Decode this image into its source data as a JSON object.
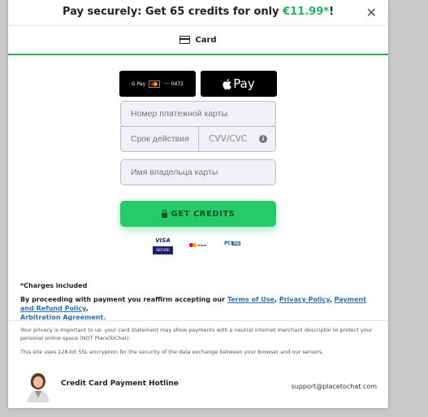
{
  "header": {
    "title_prefix": "Pay securely: Get 65 credits for only ",
    "price": "€11.99*",
    "title_suffix": "!"
  },
  "tab": {
    "label": "Card"
  },
  "wallets": {
    "gpay_label": "G Pay",
    "gpay_card": "···· 0472",
    "apple_pay_label": "Pay"
  },
  "form": {
    "card_number_placeholder": "Номер платежной карты",
    "expiry_placeholder": "Срок действия",
    "cvv_placeholder": "CVV/CVC",
    "holder_placeholder": "Имя владельца карты"
  },
  "cta": {
    "label": "GET CREDITS"
  },
  "badges": {
    "visa": "VISA",
    "visa_secure": "SECURE",
    "pci": "PCI",
    "pci_dss": "DSS"
  },
  "footer": {
    "charges": "*Charges included",
    "terms_intro": "By proceeding with payment you reaffirm accepting our ",
    "terms_of_use": "Terms of Use",
    "privacy_policy": "Privacy Policy",
    "refund_policy": "Payment and Refund Policy",
    "arbitration": "Arbitration Agreement.",
    "privacy_note": "Your privacy is important to us: your card statement may show payments with a neutral internet merchant descriptor to protect your personal online space (NOT PlaceToChat).",
    "ssl_note": "This site uses 128-bit SSL encryption for the security of the data exchange between your browser and our servers.",
    "hotline": "Credit Card Payment Hotline",
    "support_email": "support@placetochat.com"
  },
  "colors": {
    "accent": "#21b25a",
    "cta": "#25cb66",
    "link": "#2b6fb0",
    "tab_underline": "#2faa5a"
  }
}
